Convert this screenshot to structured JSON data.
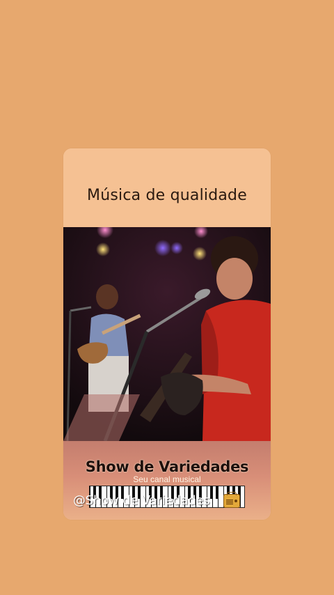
{
  "card": {
    "title": "Música de qualidade"
  },
  "video": {
    "description_icon": "concert-video"
  },
  "footer": {
    "show_title": "Show de Variedades",
    "subtitle": "Seu canal musical",
    "keyboard_icon": "piano-keyboard-icon",
    "radio_icon": "radio-icon"
  },
  "watermark": {
    "handle": "@Show de Variedades"
  },
  "colors": {
    "background": "#e7a86e",
    "card": "#f5c193",
    "accent_red": "#c8281e"
  }
}
